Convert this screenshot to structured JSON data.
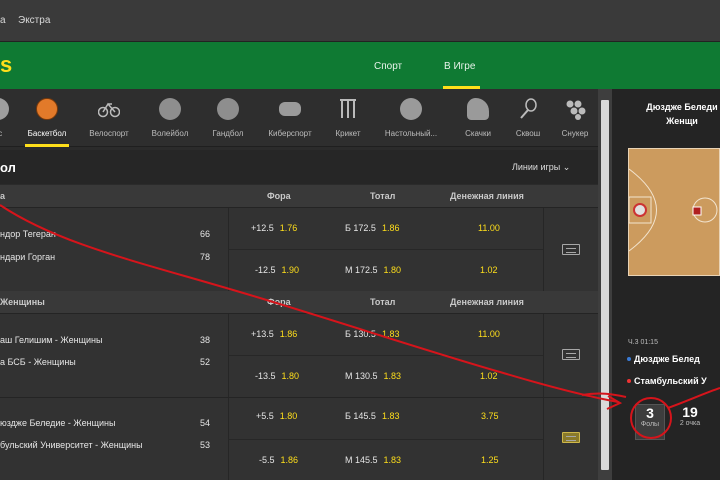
{
  "topbar": {
    "link1": "а",
    "link2": "Экстра"
  },
  "header": {
    "logo": "s",
    "nav": [
      "Спорт",
      "В Игре"
    ],
    "active_nav": "В Игре"
  },
  "sports": [
    {
      "label": "ес",
      "icon": "tennis-ball-icon"
    },
    {
      "label": "Баскетбол",
      "icon": "basketball-icon",
      "active": true
    },
    {
      "label": "Велоспорт",
      "icon": "bicycle-icon"
    },
    {
      "label": "Волейбол",
      "icon": "volleyball-icon"
    },
    {
      "label": "Гандбол",
      "icon": "handball-icon"
    },
    {
      "label": "Киберспорт",
      "icon": "gamepad-icon"
    },
    {
      "label": "Крикет",
      "icon": "cricket-icon"
    },
    {
      "label": "Настольный...",
      "icon": "table-tennis-icon"
    },
    {
      "label": "Скачки",
      "icon": "horse-racing-icon"
    },
    {
      "label": "Сквош",
      "icon": "squash-icon"
    },
    {
      "label": "Снукер",
      "icon": "snooker-icon"
    }
  ],
  "section": {
    "title": "ол",
    "lines_dropdown": "Линии игры"
  },
  "columns": {
    "fora": "Фора",
    "total": "Тотал",
    "money": "Денежная линия"
  },
  "leagues": [
    {
      "name": "а",
      "matches": [
        {
          "team1": "ндор Тегеран",
          "score1": "66",
          "team2": "ндари Горган",
          "score2": "78",
          "line1": {
            "fora": "+12.5",
            "fora_odds": "1.76",
            "total": "Б 172.5",
            "total_odds": "1.86",
            "money": "11.00"
          },
          "line2": {
            "fora": "-12.5",
            "fora_odds": "1.90",
            "total": "М 172.5",
            "total_odds": "1.80",
            "money": "1.02"
          }
        }
      ]
    },
    {
      "name": "Женщины",
      "matches": [
        {
          "team1": "аш Гелишим - Женщины",
          "score1": "38",
          "team2": "а БСБ - Женщины",
          "score2": "52",
          "line1": {
            "fora": "+13.5",
            "fora_odds": "1.86",
            "total": "Б 130.5",
            "total_odds": "1.83",
            "money": "11.00"
          },
          "line2": {
            "fora": "-13.5",
            "fora_odds": "1.80",
            "total": "М 130.5",
            "total_odds": "1.83",
            "money": "1.02"
          }
        },
        {
          "team1": "юздже Беледие - Женщины",
          "score1": "54",
          "team2": "бульский Университет - Женщины",
          "score2": "53",
          "line1": {
            "fora": "+5.5",
            "fora_odds": "1.80",
            "total": "Б 145.5",
            "total_odds": "1.83",
            "money": "3.75"
          },
          "line2": {
            "fora": "-5.5",
            "fora_odds": "1.86",
            "total": "М 145.5",
            "total_odds": "1.83",
            "money": "1.25"
          }
        }
      ]
    }
  ],
  "right_panel": {
    "title_line1": "Дюздже Беледи",
    "title_line2": "Женщи",
    "period_time": "Ч.3  01:15",
    "team1": "Дюздже Белед",
    "team2": "Стамбульский У",
    "stats": [
      {
        "value": "3",
        "caption": "Фолы"
      },
      {
        "value": "19",
        "caption": "2 очка"
      }
    ]
  },
  "colors": {
    "brand_green": "#0f7a33",
    "accent_yellow": "#ffdf1b",
    "annotation_red": "#d6141b"
  }
}
